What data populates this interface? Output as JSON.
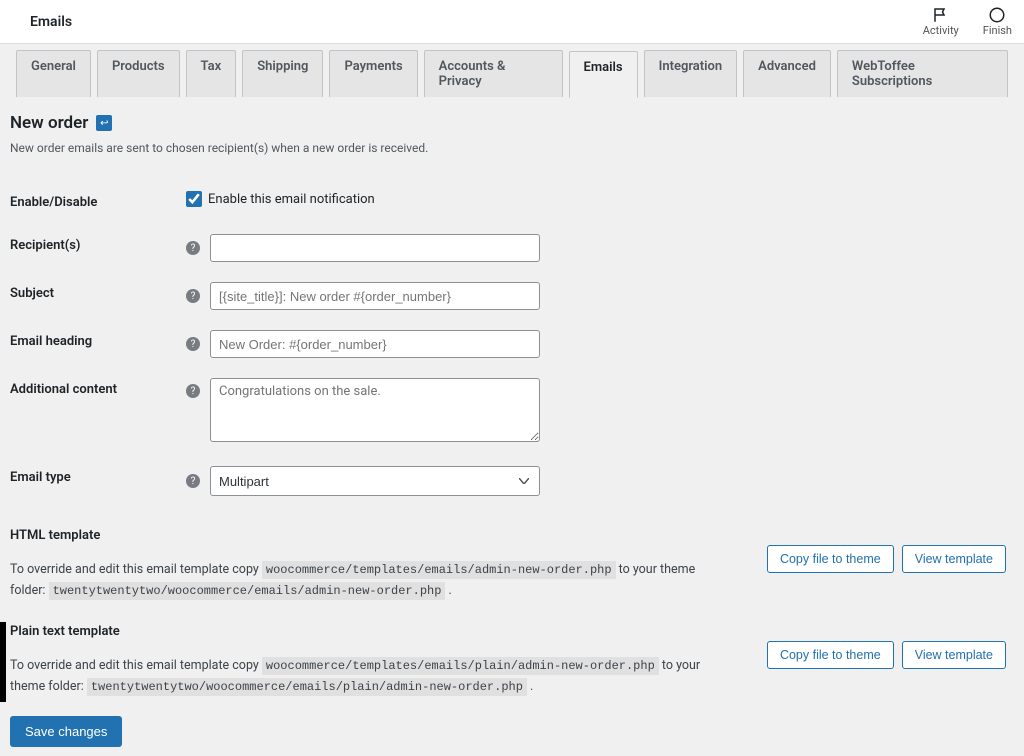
{
  "topbar": {
    "title": "Emails",
    "activity": "Activity",
    "finish": "Finish"
  },
  "tabs": [
    "General",
    "Products",
    "Tax",
    "Shipping",
    "Payments",
    "Accounts & Privacy",
    "Emails",
    "Integration",
    "Advanced",
    "WebToffee Subscriptions"
  ],
  "active_tab": "Emails",
  "page": {
    "heading": "New order",
    "desc": "New order emails are sent to chosen recipient(s) when a new order is received."
  },
  "fields": {
    "enable": {
      "label": "Enable/Disable",
      "checkbox_label": "Enable this email notification",
      "checked": true
    },
    "recipients": {
      "label": "Recipient(s)",
      "value": "                                  "
    },
    "subject": {
      "label": "Subject",
      "placeholder": "[{site_title}]: New order #{order_number}",
      "value": ""
    },
    "heading": {
      "label": "Email heading",
      "placeholder": "New Order: #{order_number}",
      "value": ""
    },
    "additional": {
      "label": "Additional content",
      "placeholder": "Congratulations on the sale.",
      "value": ""
    },
    "type": {
      "label": "Email type",
      "value": "Multipart"
    }
  },
  "html_template": {
    "title": "HTML template",
    "pre": "To override and edit this email template copy ",
    "code1": "woocommerce/templates/emails/admin-new-order.php",
    "mid": " to your theme folder: ",
    "code2": "twentytwentytwo/woocommerce/emails/admin-new-order.php",
    "tail": " .",
    "copy_btn": "Copy file to theme",
    "view_btn": "View template"
  },
  "plain_template": {
    "title": "Plain text template",
    "pre": "To override and edit this email template copy ",
    "code1": "woocommerce/templates/emails/plain/admin-new-order.php",
    "mid": " to your theme folder: ",
    "code2": "twentytwentytwo/woocommerce/emails/plain/admin-new-order.php",
    "tail": " .",
    "copy_btn": "Copy file to theme",
    "view_btn": "View template"
  },
  "save_btn": "Save changes"
}
